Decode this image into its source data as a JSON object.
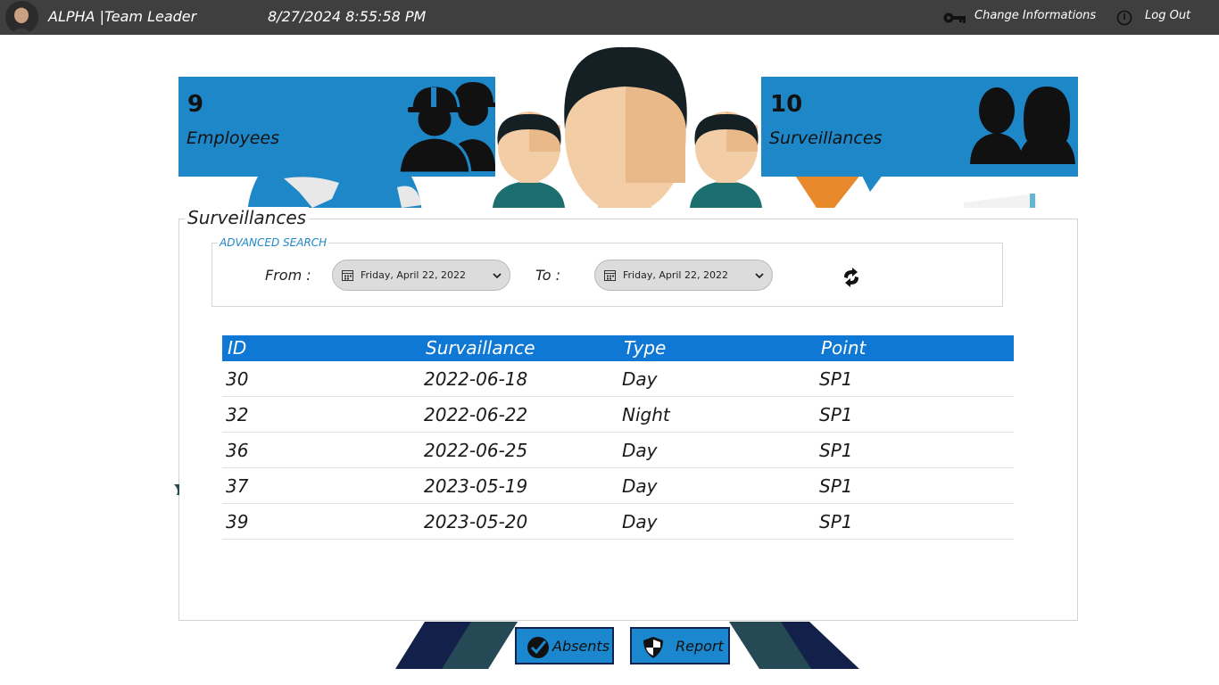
{
  "topbar": {
    "user": "ALPHA |Team Leader",
    "datetime": "8/27/2024 8:55:58 PM",
    "change_info_label": "Change Informations",
    "logout_label": "Log Out"
  },
  "stats": {
    "employees": {
      "count": "9",
      "label": "Employees",
      "icon": "workers-hardhat-icon"
    },
    "surveillances": {
      "count": "10",
      "label": "Surveillances",
      "icon": "people-pair-icon"
    }
  },
  "panel": {
    "title": "Surveillances",
    "search": {
      "legend": "ADVANCED SEARCH",
      "from_label": "From :",
      "to_label": "To :",
      "from_value": "Friday, April 22, 2022",
      "to_value": "Friday, April 22, 2022",
      "refresh_icon": "refresh-arrows-icon"
    },
    "table": {
      "columns": [
        "ID",
        "Survaillance",
        "Type",
        "Point"
      ],
      "rows": [
        [
          "30",
          "2022-06-18",
          "Day",
          "SP1"
        ],
        [
          "32",
          "2022-06-22",
          "Night",
          "SP1"
        ],
        [
          "36",
          "2022-06-25",
          "Day",
          "SP1"
        ],
        [
          "37",
          "2023-05-19",
          "Day",
          "SP1"
        ],
        [
          "39",
          "2023-05-20",
          "Day",
          "SP1"
        ]
      ]
    }
  },
  "actions": {
    "absents_label": "Absents",
    "report_label": "Report"
  },
  "colors": {
    "topbar": "#3f3f3f",
    "card_blue": "#1e87c8",
    "table_header": "#0f78d4",
    "navy": "#0f2350",
    "teal_dark": "#254a55"
  }
}
